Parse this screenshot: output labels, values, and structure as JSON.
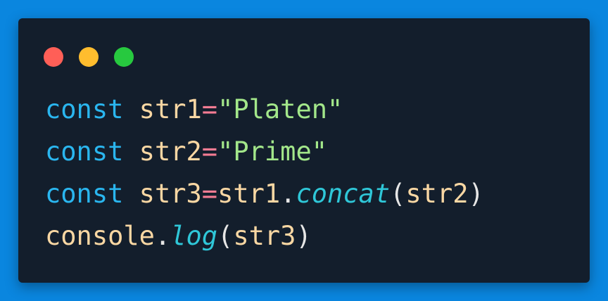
{
  "window": {
    "controls": [
      {
        "name": "close",
        "color": "#ff5f57"
      },
      {
        "name": "minimize",
        "color": "#ffbd2e"
      },
      {
        "name": "maximize",
        "color": "#27c93f"
      }
    ]
  },
  "code": {
    "lines": [
      [
        "const",
        " ",
        "str1",
        "=",
        "\"Platen\""
      ],
      [
        "const",
        " ",
        "str2",
        "=",
        "\"Prime\""
      ],
      [
        "const",
        " ",
        "str3",
        "=",
        "str1",
        ".",
        "concat",
        "(",
        "str2",
        ")"
      ],
      [
        "console",
        ".",
        "log",
        "(",
        "str3",
        ")"
      ]
    ]
  }
}
